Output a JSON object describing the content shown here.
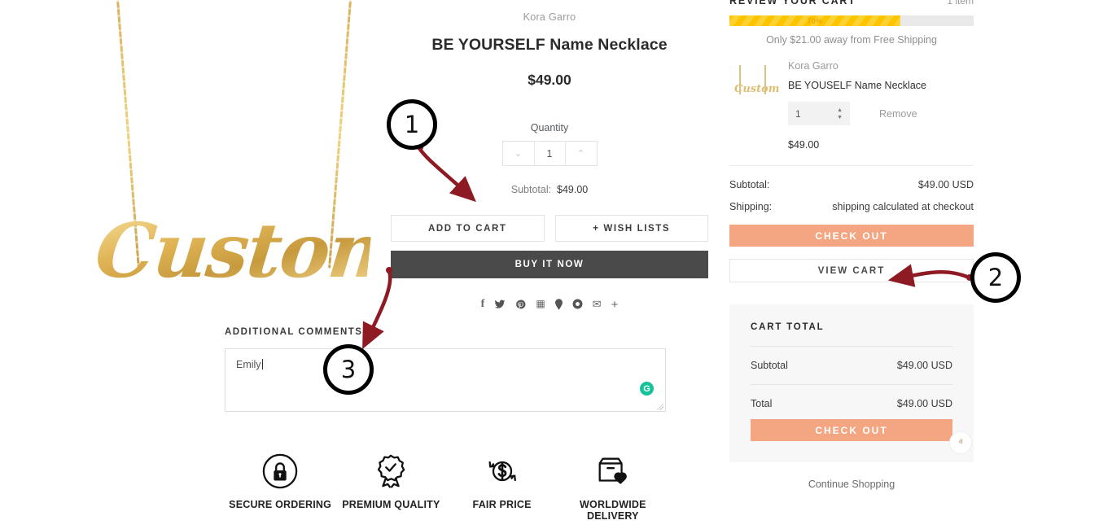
{
  "product": {
    "brand": "Kora Garro",
    "title": "BE YOURSELF Name Necklace",
    "price": "$49.00",
    "quantity_label": "Quantity",
    "quantity_value": "1",
    "subtotal_label": "Subtotal:",
    "subtotal_value": "$49.00",
    "add_to_cart": "ADD TO CART",
    "wish_lists": "+ WISH LISTS",
    "buy_it_now": "BUY IT NOW",
    "image_word": "Custom",
    "social_icons": [
      {
        "name": "facebook-icon",
        "glyph": "f"
      },
      {
        "name": "twitter-icon",
        "glyph": "🐦"
      },
      {
        "name": "pinterest-icon",
        "glyph": "р"
      },
      {
        "name": "grid-icon",
        "glyph": "☷"
      },
      {
        "name": "pin-icon",
        "glyph": "📍"
      },
      {
        "name": "tumblr-circle-icon",
        "glyph": "●"
      },
      {
        "name": "email-icon",
        "glyph": "✉"
      },
      {
        "name": "more-plus-icon",
        "glyph": "+"
      }
    ]
  },
  "comments": {
    "label": "ADDITIONAL COMMENTS",
    "value": "Emily",
    "grammarly_icon": "G"
  },
  "badges": [
    {
      "icon": "lock-circle-icon",
      "label": "SECURE ORDERING"
    },
    {
      "icon": "award-ribbon-check-icon",
      "label": "PREMIUM QUALITY"
    },
    {
      "icon": "dollar-refresh-icon",
      "label": "FAIR PRICE"
    },
    {
      "icon": "box-heart-delivery-icon",
      "label": "WORLDWIDE DELIVERY"
    }
  ],
  "cart": {
    "header_title": "REVIEW YOUR CART",
    "header_count": "1 item",
    "progress_percent_label": "70%",
    "progress_percent": 70,
    "free_shipping_note": "Only $21.00 away from Free Shipping",
    "item": {
      "brand": "Kora Garro",
      "name": "BE YOUSELF Name Necklace",
      "quantity": "1",
      "remove_label": "Remove",
      "price": "$49.00",
      "thumb_word": "Custom"
    },
    "subtotal_label": "Subtotal:",
    "subtotal_value": "$49.00 USD",
    "shipping_label": "Shipping:",
    "shipping_value": "shipping calculated at checkout",
    "checkout_label": "CHECK OUT",
    "view_cart_label": "VIEW CART",
    "total_card": {
      "title": "CART TOTAL",
      "subtotal_label": "Subtotal",
      "subtotal_value": "$49.00 USD",
      "total_label": "Total",
      "total_value": "$49.00 USD",
      "checkout_label": "CHECK OUT"
    },
    "continue_shopping": "Continue Shopping",
    "scroll_top_icon": "ⱏ"
  },
  "annotations": [
    {
      "number": "1",
      "target": "add-to-cart-button"
    },
    {
      "number": "2",
      "target": "view-cart-button"
    },
    {
      "number": "3",
      "target": "additional-comments-textarea"
    }
  ],
  "colors": {
    "accent_coral": "#f4a683",
    "progress_yellow": "#ffc400",
    "annotation_red": "#8e1a24",
    "buy_now_dark": "#4a4a4a",
    "gold": "#e0b455"
  }
}
